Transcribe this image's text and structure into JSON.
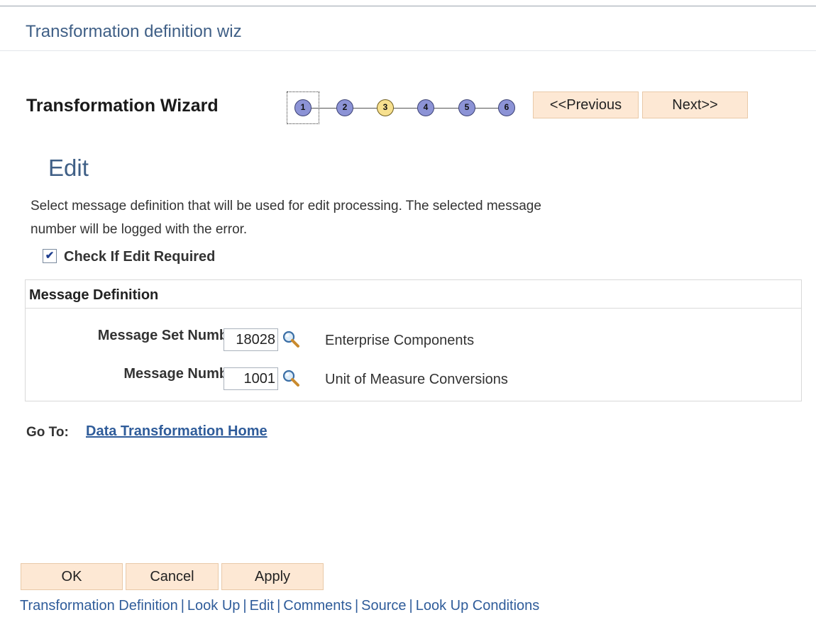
{
  "window": {
    "title": "Transformation definition wiz"
  },
  "wizard": {
    "label": "Transformation Wizard",
    "steps": [
      "1",
      "2",
      "3",
      "4",
      "5",
      "6"
    ],
    "current_step": "3",
    "focused_step": "1",
    "prev_label": "<<Previous",
    "next_label": "Next>>"
  },
  "section": {
    "title": "Edit",
    "description": "Select message definition that will be used for edit processing. The selected message number will be logged with the error.",
    "checkbox_label": "Check If Edit Required",
    "checkbox_checked": true
  },
  "message_definition": {
    "title": "Message Definition",
    "set_number_label": "Message Set Number",
    "set_number_value": "18028",
    "set_number_desc": "Enterprise Components",
    "message_number_label": "Message Number",
    "message_number_value": "1001",
    "message_number_desc": "Unit of Measure Conversions"
  },
  "goto": {
    "label": "Go To:",
    "link": "Data Transformation Home"
  },
  "buttons": {
    "ok": "OK",
    "cancel": "Cancel",
    "apply": "Apply"
  },
  "footer_links": [
    "Transformation Definition",
    "Look Up",
    "Edit",
    "Comments",
    "Source",
    "Look Up Conditions"
  ],
  "icons": {
    "lookup": "magnifier-icon",
    "check": "checkmark-icon"
  },
  "colors": {
    "accent": "#3f5f86",
    "link": "#2f5c9a",
    "button_bg": "#fde8d4",
    "step": "#8c93d6",
    "step_current": "#f7e08e"
  }
}
